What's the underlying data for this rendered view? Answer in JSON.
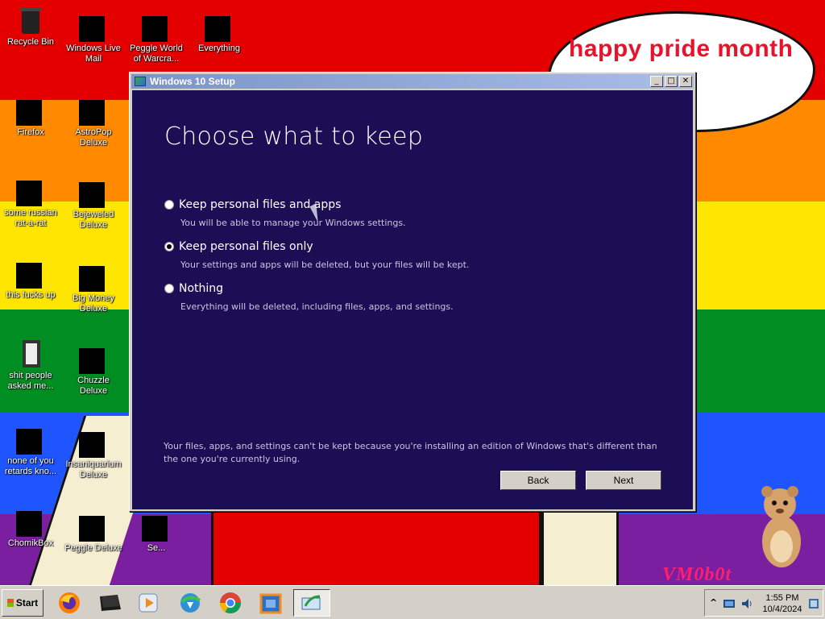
{
  "desktop": {
    "bubble_text": "happy pride month",
    "watermark": "VM0b0t",
    "icons": [
      {
        "label": "Recycle Bin",
        "icon": "recycle-bin-icon"
      },
      {
        "label": "Windows Live Mail",
        "icon": "mail-icon"
      },
      {
        "label": "Peggle World of Warcra...",
        "icon": "peggle-icon"
      },
      {
        "label": "Everything",
        "icon": "search-app-icon"
      },
      {
        "label": "Firefox",
        "icon": "firefox-icon"
      },
      {
        "label": "AstroPop Deluxe",
        "icon": "astropop-icon"
      },
      {
        "label": "some russian rat-a-rat",
        "icon": "app-icon"
      },
      {
        "label": "Bejeweled Deluxe",
        "icon": "bejeweled-icon"
      },
      {
        "label": "this fucks up",
        "icon": "windows-stack-icon"
      },
      {
        "label": "Big Money Deluxe",
        "icon": "money-bag-icon"
      },
      {
        "label": "shit people asked me...",
        "icon": "document-icon"
      },
      {
        "label": "Chuzzle Deluxe",
        "icon": "chuzzle-icon"
      },
      {
        "label": "none of you retards kno...",
        "icon": "app-icon"
      },
      {
        "label": "Insaniquarium Deluxe",
        "icon": "fish-icon"
      },
      {
        "label": "ChomikBox",
        "icon": "chomikbox-icon"
      },
      {
        "label": "Peggle Deluxe",
        "icon": "peggle-icon"
      },
      {
        "label": "Se...",
        "icon": "app-icon"
      }
    ]
  },
  "window": {
    "title": "Windows 10 Setup",
    "heading": "Choose what to keep",
    "options": [
      {
        "label": "Keep personal files and apps",
        "desc": "You will be able to manage your Windows settings.",
        "checked": false
      },
      {
        "label": "Keep personal files only",
        "desc": "Your settings and apps will be deleted, but your files will be kept.",
        "checked": true
      },
      {
        "label": "Nothing",
        "desc": "Everything will be deleted, including files, apps, and settings.",
        "checked": false
      }
    ],
    "note": "Your files, apps, and settings can't be kept because you're installing an edition of Windows that's different than the one you're currently using.",
    "back_label": "Back",
    "next_label": "Next",
    "minimize_glyph": "_",
    "maximize_glyph": "□",
    "close_glyph": "✕"
  },
  "taskbar": {
    "start_label": "Start",
    "apps": [
      {
        "name": "firefox-icon"
      },
      {
        "name": "terminal-icon"
      },
      {
        "name": "media-player-icon"
      },
      {
        "name": "download-manager-icon"
      },
      {
        "name": "chrome-icon"
      },
      {
        "name": "virtualbox-icon"
      },
      {
        "name": "windows-setup-icon",
        "active": true
      }
    ],
    "tray_chevron": "^",
    "time": "1:55 PM",
    "date": "10/4/2024"
  }
}
